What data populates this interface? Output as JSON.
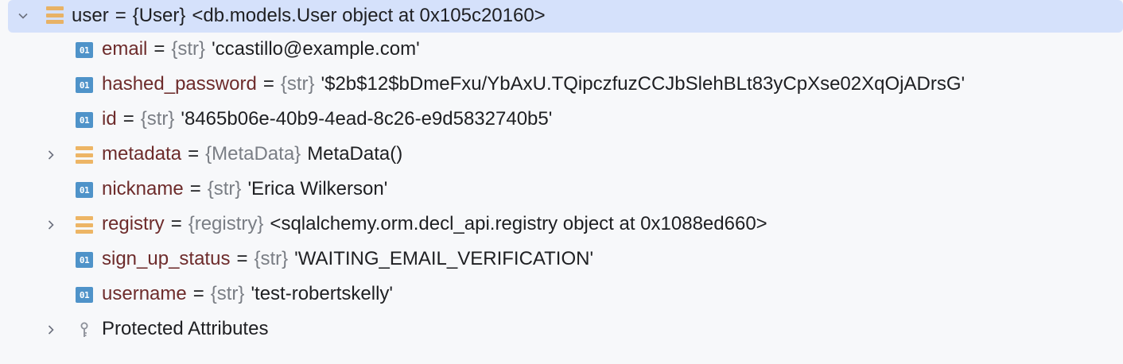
{
  "tree": {
    "root": {
      "name": "user",
      "type": "{User}",
      "value": "<db.models.User object at 0x105c20160>"
    },
    "children": [
      {
        "name": "email",
        "type": "{str}",
        "value": "'ccastillo@example.com'"
      },
      {
        "name": "hashed_password",
        "type": "{str}",
        "value": "'$2b$12$bDmeFxu/YbAxU.TQipczfuzCCJbSlehBLt83yCpXse02XqOjADrsG'"
      },
      {
        "name": "id",
        "type": "{str}",
        "value": "'8465b06e-40b9-4ead-8c26-e9d5832740b5'"
      },
      {
        "name": "metadata",
        "type": "{MetaData}",
        "value": "MetaData()"
      },
      {
        "name": "nickname",
        "type": "{str}",
        "value": "'Erica Wilkerson'"
      },
      {
        "name": "registry",
        "type": "{registry}",
        "value": "<sqlalchemy.orm.decl_api.registry object at 0x1088ed660>"
      },
      {
        "name": "sign_up_status",
        "type": "{str}",
        "value": "'WAITING_EMAIL_VERIFICATION'"
      },
      {
        "name": "username",
        "type": "{str}",
        "value": "'test-robertskelly'"
      }
    ],
    "protected_label": "Protected Attributes",
    "icon_label_primitive": "01"
  },
  "colors": {
    "selection": "#d5e1fb",
    "name": "#6d2b2b",
    "type": "#7a7e85",
    "object_icon": "#eba94a",
    "primitive_icon": "#4f93c9"
  }
}
